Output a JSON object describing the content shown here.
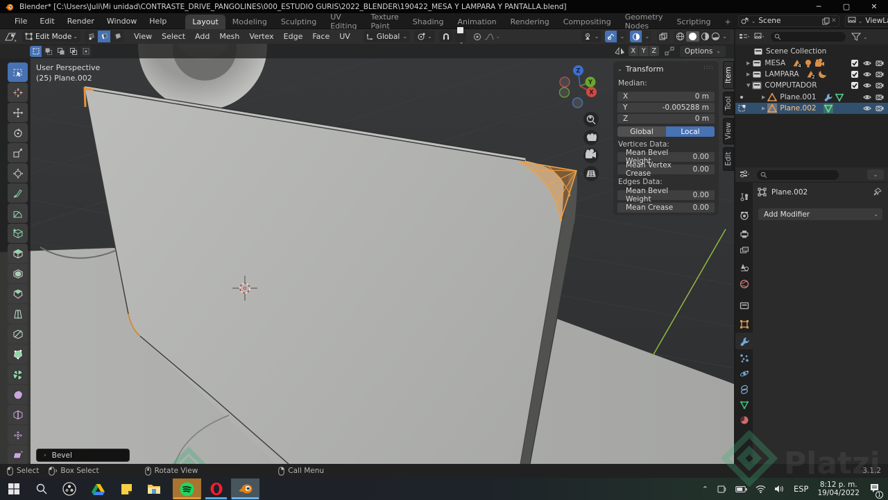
{
  "titlebar": {
    "title": "Blender* [C:\\Users\\Juli\\Mi unidad\\CONTRASTE_DRIVE_PANGOLINES\\000_ESTUDIO GURIS\\2022_BLENDER\\190422_MESA Y LAMPARA Y PANTALLA.blend]"
  },
  "topbar": {
    "menus": [
      {
        "label": "File"
      },
      {
        "label": "Edit"
      },
      {
        "label": "Render"
      },
      {
        "label": "Window"
      },
      {
        "label": "Help"
      }
    ],
    "workspaces": [
      {
        "label": "Layout",
        "cls": "active"
      },
      {
        "label": "Modeling"
      },
      {
        "label": "Sculpting"
      },
      {
        "label": "UV Editing"
      },
      {
        "label": "Texture Paint"
      },
      {
        "label": "Shading"
      },
      {
        "label": "Animation"
      },
      {
        "label": "Rendering"
      },
      {
        "label": "Compositing"
      },
      {
        "label": "Geometry Nodes"
      },
      {
        "label": "Scripting"
      }
    ],
    "add_workspace": "+",
    "scene_label": "Scene",
    "viewlayer_label": "ViewLayer"
  },
  "viewport_header": {
    "mode": "Edit Mode",
    "menus": [
      {
        "label": "View"
      },
      {
        "label": "Select"
      },
      {
        "label": "Add"
      },
      {
        "label": "Mesh"
      },
      {
        "label": "Vertex"
      },
      {
        "label": "Edge"
      },
      {
        "label": "Face"
      },
      {
        "label": "UV"
      }
    ],
    "orientation": "Global",
    "mirror_x": "X",
    "mirror_y": "Y",
    "mirror_z": "Z",
    "options_label": "Options"
  },
  "viewport": {
    "overlay_line1": "User Perspective",
    "overlay_line2": "(25) Plane.002",
    "axis_x": "X",
    "axis_y": "Y",
    "axis_z": "Z",
    "operator_panel_label": "Bevel"
  },
  "npanel": {
    "title": "Transform",
    "tabs": [
      {
        "label": "Item",
        "cls": "active"
      },
      {
        "label": "Tool"
      },
      {
        "label": "View"
      },
      {
        "label": "Edit"
      }
    ],
    "median_label": "Median:",
    "median": [
      {
        "axis": "X",
        "value": "0 m"
      },
      {
        "axis": "Y",
        "value": "-0.005288 m"
      },
      {
        "axis": "Z",
        "value": "0 m"
      }
    ],
    "global_label": "Global",
    "local_label": "Local",
    "vertices_label": "Vertices Data:",
    "vertex_fields": [
      {
        "label": "Mean Bevel Weight",
        "value": "0.00"
      },
      {
        "label": "Mean Vertex Crease",
        "value": "0.00"
      }
    ],
    "edges_label": "Edges Data:",
    "edge_fields": [
      {
        "label": "Mean Bevel Weight",
        "value": "0.00"
      },
      {
        "label": "Mean Crease",
        "value": "0.00"
      }
    ]
  },
  "outliner": {
    "scene_collection": "Scene Collection",
    "mesa": "MESA",
    "mesa_count": "4",
    "lampara": "LAMPARA",
    "lampara_count": "2",
    "computador": "COMPUTADOR",
    "plane001": "Plane.001",
    "plane002": "Plane.002"
  },
  "properties": {
    "breadcrumb": "Plane.002",
    "add_modifier": "Add Modifier"
  },
  "statusbar": {
    "select": "Select",
    "box_select": "Box Select",
    "rotate_view": "Rotate View",
    "call_menu": "Call Menu",
    "version": "3.1.2"
  },
  "taskbar": {
    "language": "ESP",
    "time": "8:12 p. m.",
    "date": "19/04/2022",
    "badge": "1"
  },
  "colors": {
    "accent": "#4772b3",
    "selection_orange": "#f3a143",
    "axis_green": "#8db33f"
  }
}
